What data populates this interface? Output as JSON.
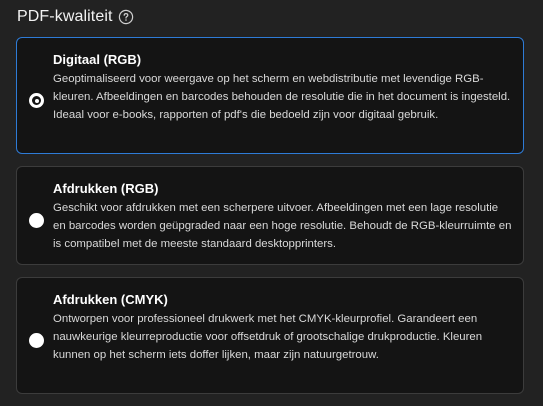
{
  "section": {
    "title": "PDF-kwaliteit",
    "help_icon": "question-circle-icon"
  },
  "options": [
    {
      "title": "Digitaal (RGB)",
      "description": "Geoptimaliseerd voor weergave op het scherm en webdistributie met levendige RGB-kleuren. Afbeeldingen en barcodes behouden de resolutie die in het document is ingesteld. Ideaal voor e-books, rapporten of pdf's die bedoeld zijn voor digitaal gebruik.",
      "selected": true
    },
    {
      "title": "Afdrukken (RGB)",
      "description": "Geschikt voor afdrukken met een scherpere uitvoer. Afbeeldingen met een lage resolutie en barcodes worden geüpgraded naar een hoge resolutie. Behoudt de RGB-kleurruimte en is compatibel met de meeste standaard desktopprinters.",
      "selected": false
    },
    {
      "title": "Afdrukken (CMYK)",
      "description": "Ontworpen voor professioneel drukwerk met het CMYK-kleurprofiel. Garandeert een nauwkeurige kleurreproductie voor offsetdruk of grootschalige drukproductie. Kleuren kunnen op het scherm iets doffer lijken, maar zijn natuurgetrouw.",
      "selected": false
    }
  ],
  "colors": {
    "background": "#222222",
    "card_background": "#141414",
    "card_border": "#3c3c3c",
    "selected_border": "#2e7bd6",
    "text_primary": "#ffffff",
    "text_secondary": "#d9d9d9"
  }
}
